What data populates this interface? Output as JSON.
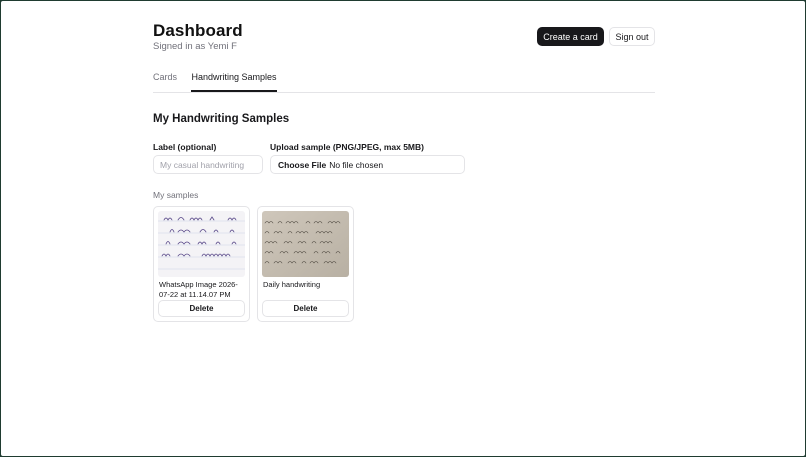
{
  "header": {
    "title": "Dashboard",
    "subtitle": "Signed in as Yemi F",
    "create_label": "Create a card",
    "signout_label": "Sign out"
  },
  "tabs": [
    {
      "label": "Cards",
      "active": false
    },
    {
      "label": "Handwriting Samples",
      "active": true
    }
  ],
  "section": {
    "title": "My Handwriting Samples",
    "label_field": {
      "label": "Label (optional)",
      "placeholder": "My casual handwriting",
      "value": ""
    },
    "upload_field": {
      "label": "Upload sample (PNG/JPEG, max 5MB)",
      "button_label": "Choose File",
      "status": "No file chosen"
    },
    "samples_heading": "My samples",
    "samples": [
      {
        "label": "WhatsApp Image 2026-07-22 at 11.14.07 PM",
        "delete_label": "Delete",
        "thumbnail": "handwriting-lined-paper"
      },
      {
        "label": "Daily handwriting",
        "delete_label": "Delete",
        "thumbnail": "handwriting-beige-paper"
      }
    ]
  },
  "colors": {
    "primary": "#18181b",
    "muted": "#71717a",
    "border": "#e4e4e7",
    "page_edge": "#1f3b30"
  }
}
